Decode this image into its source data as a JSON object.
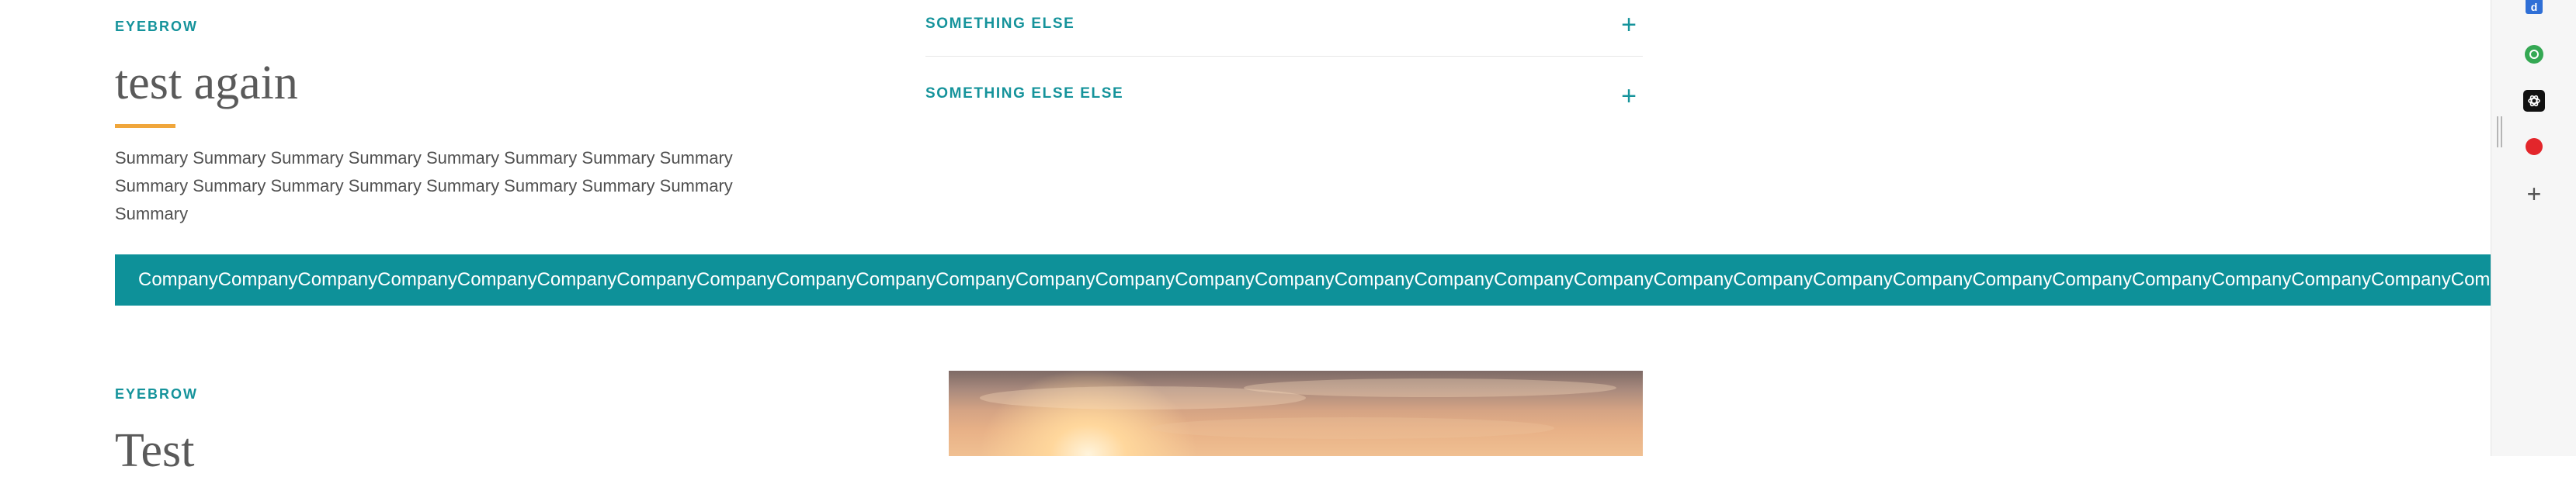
{
  "section1": {
    "eyebrow": "EYEBROW",
    "title": "test again",
    "summary_lines": [
      "Summary Summary Summary Summary Summary Summary Summary Summary",
      "Summary Summary Summary Summary Summary Summary Summary Summary",
      "Summary"
    ]
  },
  "accordion": {
    "items": [
      {
        "label": "SOMETHING ELSE",
        "icon": "plus-icon"
      },
      {
        "label": "SOMETHING ELSE ELSE",
        "icon": "plus-icon"
      }
    ]
  },
  "banner": {
    "text": "CompanyCompanyCompanyCompanyCompanyCompanyCompanyCompanyCompanyCompanyCompanyCompanyCompanyCompanyCompanyCompanyCompanyCompanyCompanyCompanyCompanyCompanyCompanyCompanyCompanyCompanyCompanyCompanyCompanyCompa"
  },
  "section2": {
    "eyebrow": "EYEBROW",
    "title": "Test"
  },
  "sidebar": {
    "icons": [
      {
        "name": "docs-app-icon",
        "glyph": "d",
        "color": "#2f6fd6"
      },
      {
        "name": "green-circle-app-icon",
        "color": "#34a853"
      },
      {
        "name": "openai-app-icon",
        "color": "#111111"
      },
      {
        "name": "red-dot-app-icon",
        "color": "#e3262b"
      },
      {
        "name": "add-icon",
        "glyph": "+"
      }
    ]
  },
  "colors": {
    "accent": "#15939b",
    "banner": "#0e9199",
    "title_rule": "#f0a63b"
  }
}
